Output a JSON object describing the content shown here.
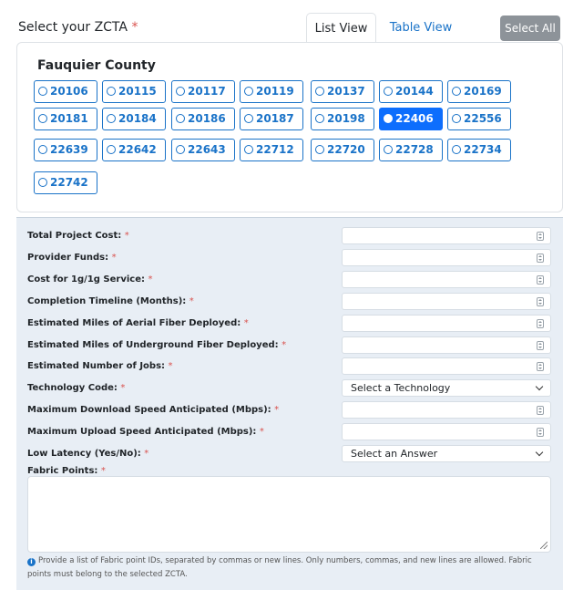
{
  "header": {
    "title": "Select your ZCTA",
    "required_mark": "*",
    "tabs": [
      {
        "label": "List View",
        "active": true
      },
      {
        "label": "Table View",
        "active": false
      }
    ],
    "select_all_label": "Select All"
  },
  "county": {
    "name": "Fauquier County",
    "selected": "22406",
    "zctas": [
      "20106",
      "20115",
      "20117",
      "20119",
      "20137",
      "20144",
      "20169",
      "20181",
      "20184",
      "20186",
      "20187",
      "20198",
      "22406",
      "22556",
      "22639",
      "22642",
      "22643",
      "22712",
      "22720",
      "22728",
      "22734",
      "22742"
    ]
  },
  "form": {
    "required_mark": "*",
    "fields": [
      {
        "label": "Total Project Cost:",
        "type": "number",
        "value": ""
      },
      {
        "label": "Provider Funds:",
        "type": "number",
        "value": ""
      },
      {
        "label": "Cost for 1g/1g Service:",
        "type": "number",
        "value": ""
      },
      {
        "label": "Completion Timeline (Months):",
        "type": "number",
        "value": ""
      },
      {
        "label": "Estimated Miles of Aerial Fiber Deployed:",
        "type": "number",
        "value": ""
      },
      {
        "label": "Estimated Miles of Underground Fiber Deployed:",
        "type": "number",
        "value": ""
      },
      {
        "label": "Estimated Number of Jobs:",
        "type": "number",
        "value": ""
      },
      {
        "label": "Technology Code:",
        "type": "select",
        "value": "Select a Technology"
      },
      {
        "label": "Maximum Download Speed Anticipated (Mbps):",
        "type": "number",
        "value": ""
      },
      {
        "label": "Maximum Upload Speed Anticipated (Mbps):",
        "type": "number",
        "value": ""
      },
      {
        "label": "Low Latency (Yes/No):",
        "type": "select",
        "value": "Select an Answer"
      }
    ],
    "fabric_label": "Fabric Points:",
    "fabric_value": "",
    "help_line1": "Provide a list of Fabric point IDs, separated by commas or new lines. Only numbers, commas, and new lines are allowed. Fabric",
    "help_line2": "points must belong to the selected ZCTA."
  },
  "colors": {
    "accent": "#1a73c8",
    "selected": "#0d6efd",
    "panel": "#e8eef5",
    "required": "#d9534f"
  }
}
